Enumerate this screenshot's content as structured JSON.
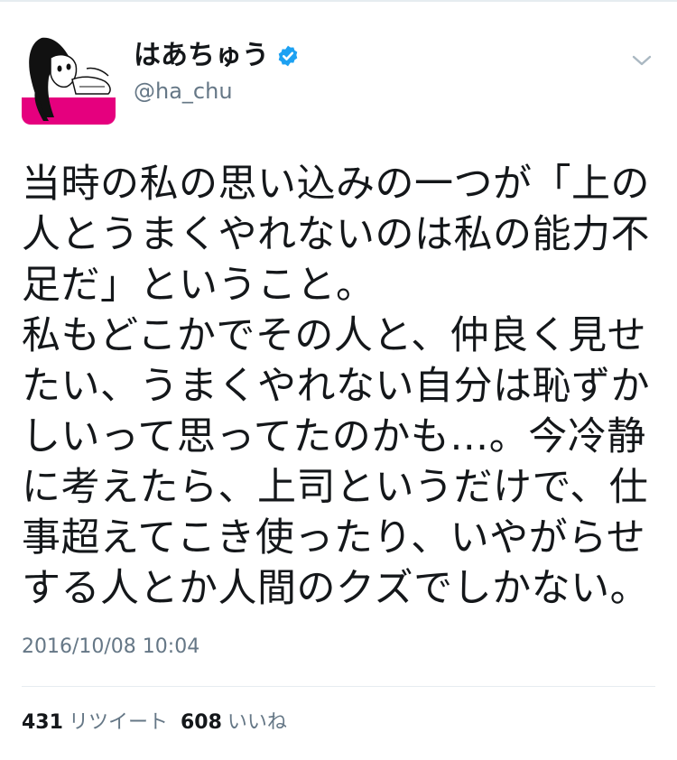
{
  "user": {
    "display_name": "はあちゅう",
    "handle": "@ha_chu",
    "verified": true,
    "verified_icon": "verified-badge-icon",
    "avatar_icon": "avatar-illustration"
  },
  "tweet": {
    "text": "当時の私の思い込みの一つが「上の人とうまくやれないのは私の能力不足だ」ということ。\n私もどこかでその人と、仲良く見せたい、うまくやれない自分は恥ずかしいって思ってたのかも…。今冷静に考えたら、上司というだけで、仕事超えてこき使ったり、いやがらせする人とか人間のクズでしかない。",
    "timestamp": "2016/10/08 10:04"
  },
  "stats": {
    "retweets_count": "431",
    "retweets_label": "リツイート",
    "likes_count": "608",
    "likes_label": "いいね"
  },
  "colors": {
    "text_primary": "#14171a",
    "text_secondary": "#657786",
    "verified_blue": "#1da1f2",
    "divider": "#e6ecf0",
    "avatar_pink": "#e5007e"
  },
  "menu": {
    "icon": "chevron-down-icon"
  }
}
